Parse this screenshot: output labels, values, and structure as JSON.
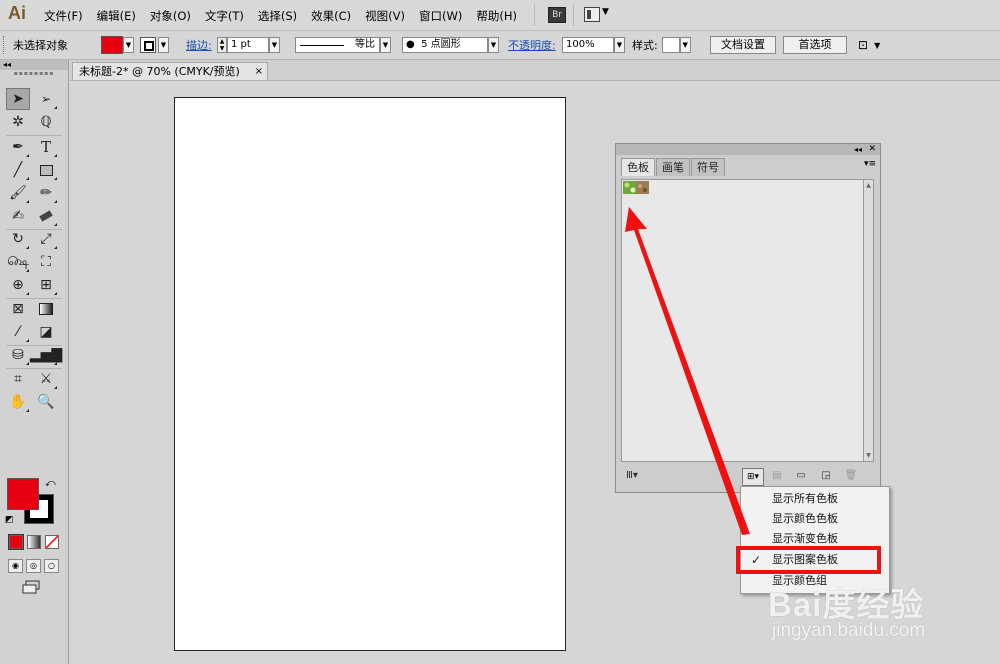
{
  "app": {
    "logo_text": "Ai",
    "menu": [
      "文件(F)",
      "编辑(E)",
      "对象(O)",
      "文字(T)",
      "选择(S)",
      "效果(C)",
      "视图(V)",
      "窗口(W)",
      "帮助(H)"
    ],
    "bridge_label": "Br"
  },
  "control_bar": {
    "selection_status": "未选择对象",
    "fill_color": "#e60012",
    "stroke_label": "描边:",
    "stroke_weight": "1 pt",
    "stroke_profile": "等比",
    "brush_label": "5 点圆形",
    "opacity_label": "不透明度:",
    "opacity_value": "100%",
    "style_label": "样式:",
    "doc_setup_button": "文档设置",
    "preferences_button": "首选项"
  },
  "document": {
    "tab_title": "未标题-2* @ 70% (CMYK/预览)",
    "close_glyph": "×"
  },
  "tools": {
    "fill_color": "#e60012",
    "stroke_color": "#000000"
  },
  "swatches_panel": {
    "tabs": [
      "色板",
      "画笔",
      "符号"
    ],
    "active_tab": "色板"
  },
  "swatch_menu": {
    "items": [
      "显示所有色板",
      "显示颜色色板",
      "显示渐变色板",
      "显示图案色板",
      "显示颜色组"
    ],
    "checked_item": "显示图案色板",
    "check_glyph": "✓"
  },
  "annotations": {
    "highlight_color": "#ee1111",
    "arrow_color": "#ee1111"
  },
  "watermark": {
    "brand": "Bai度经验",
    "url": "jingyan.baidu.com"
  }
}
